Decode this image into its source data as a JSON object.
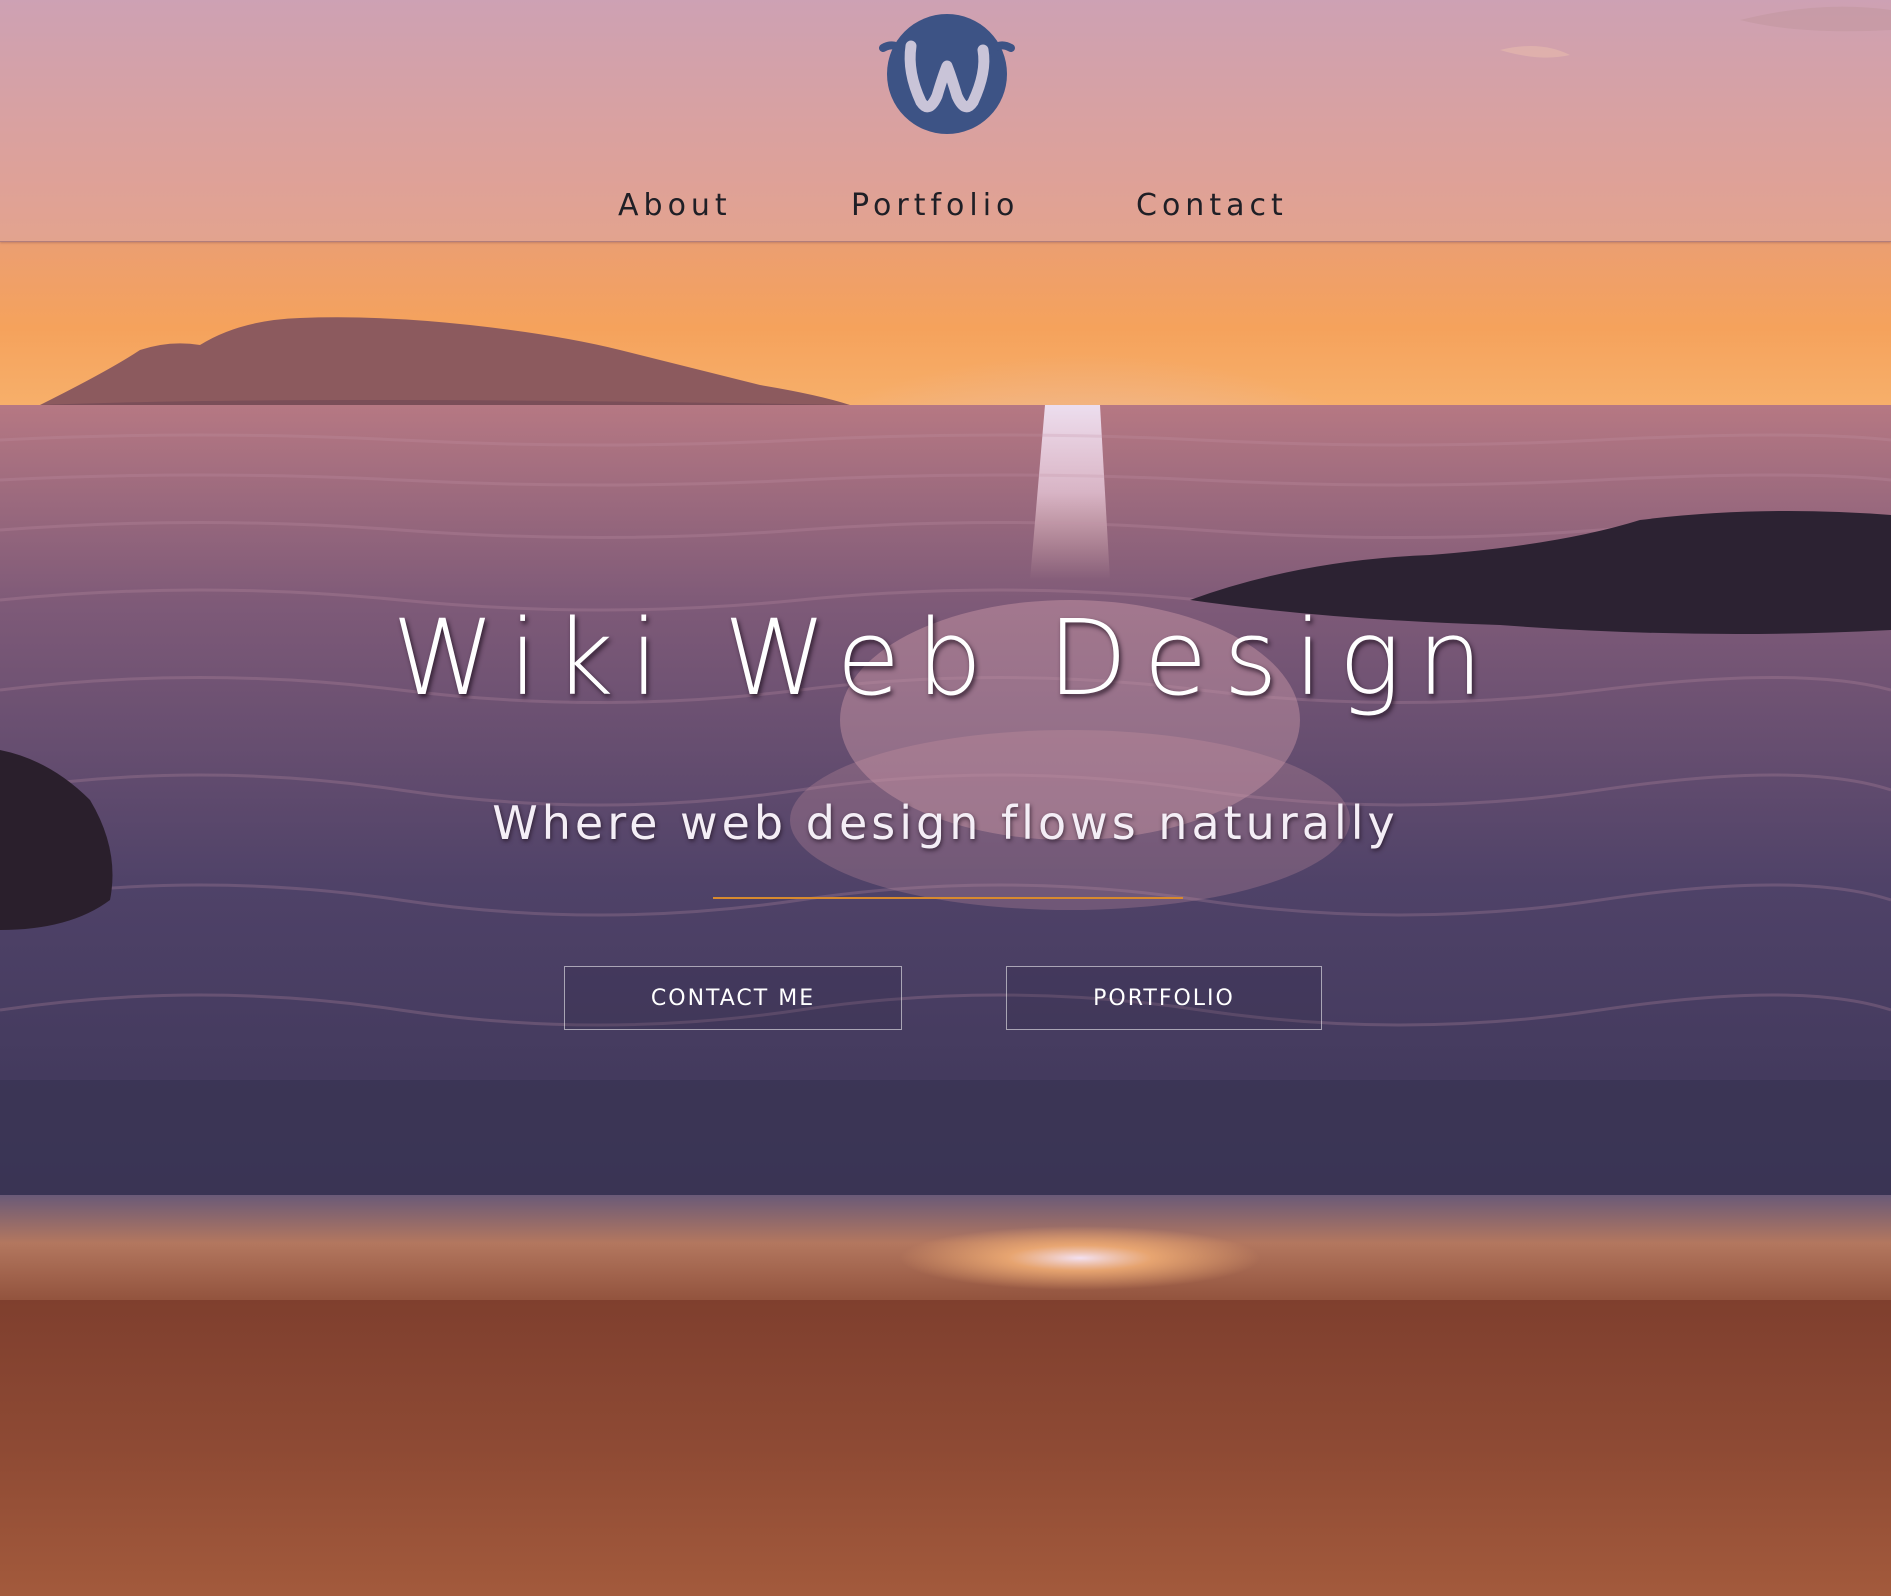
{
  "brand": {
    "logo_letter": "W",
    "logo_color": "#3d5385",
    "accent_color": "#d88a2e"
  },
  "nav": {
    "items": [
      {
        "label": "About"
      },
      {
        "label": "Portfolio"
      },
      {
        "label": "Contact"
      }
    ]
  },
  "hero": {
    "title": "Wiki Web Design",
    "subtitle": "Where web design flows naturally",
    "buttons": {
      "contact_label": "CONTACT ME",
      "portfolio_label": "PORTFOLIO"
    }
  }
}
